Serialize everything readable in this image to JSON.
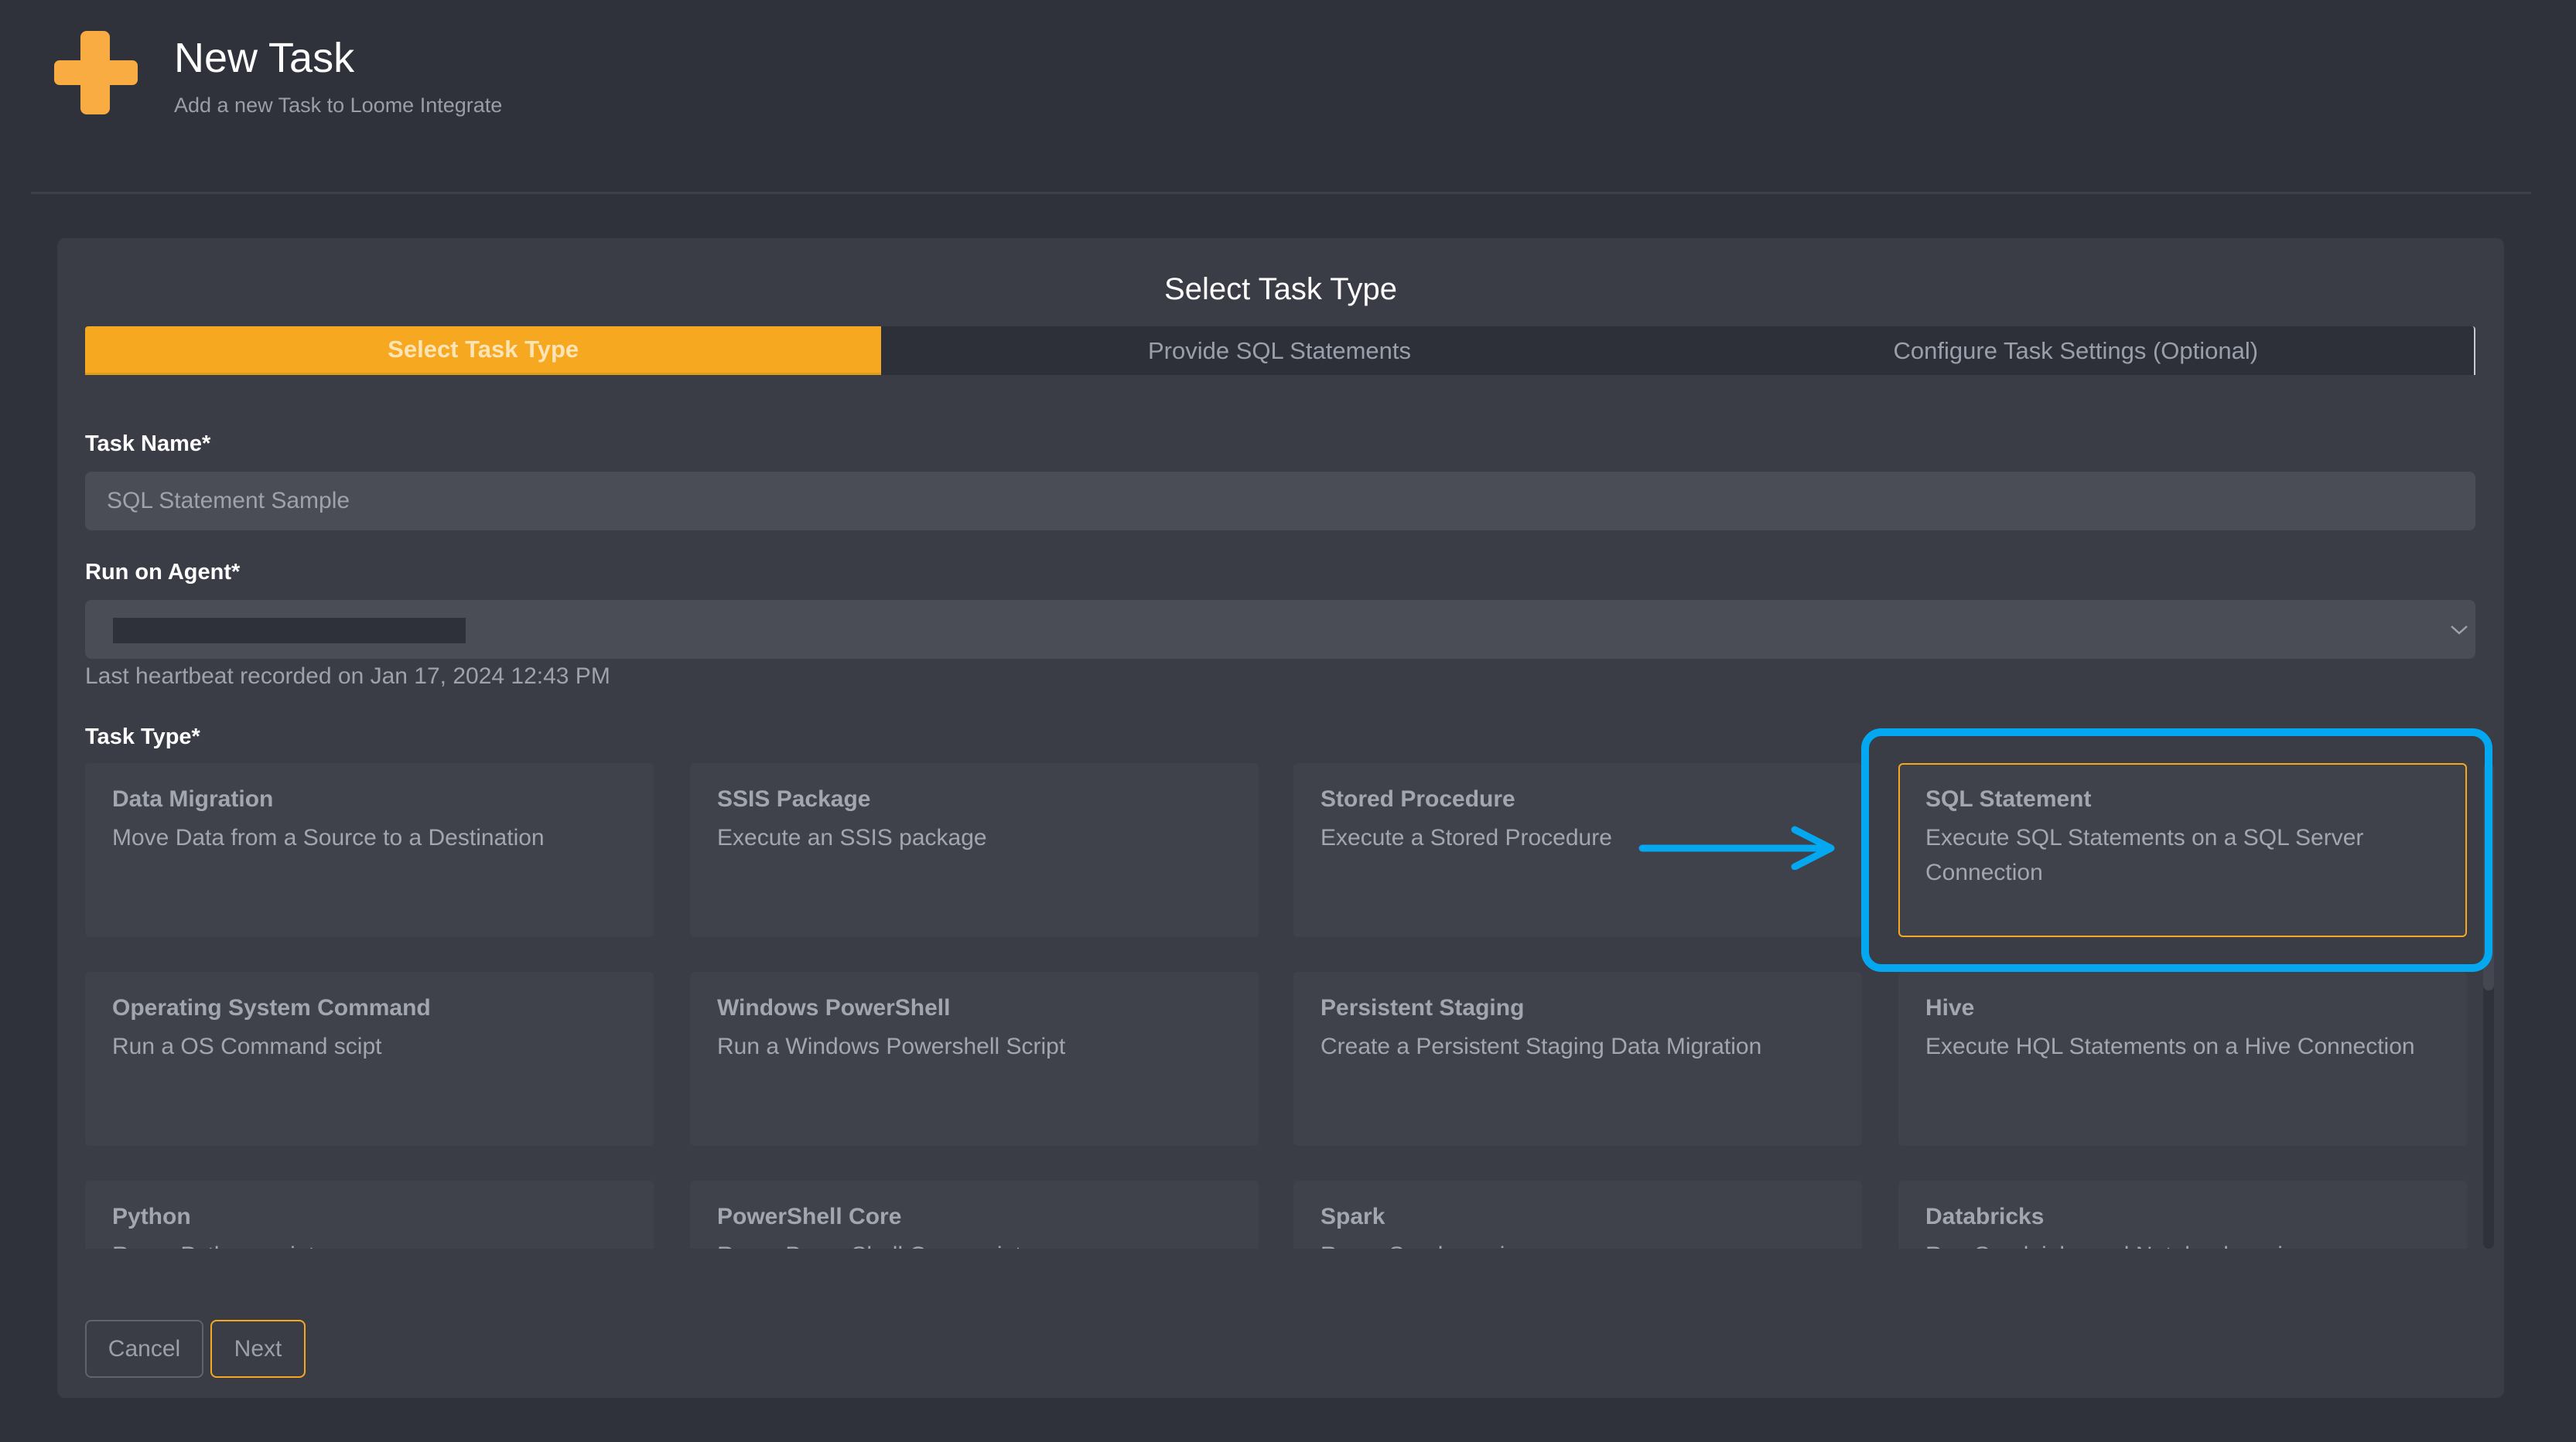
{
  "header": {
    "icon": "plus-icon",
    "title": "New Task",
    "subtitle": "Add a new Task to Loome Integrate"
  },
  "wizard": {
    "title": "Select Task Type",
    "steps": [
      {
        "label": "Select Task Type",
        "active": true
      },
      {
        "label": "Provide SQL Statements",
        "active": false
      },
      {
        "label": "Configure Task Settings (Optional)",
        "active": false
      }
    ]
  },
  "form": {
    "task_name": {
      "label": "Task Name*",
      "value": "SQL Statement Sample"
    },
    "run_on_agent": {
      "label": "Run on Agent*",
      "value": "[redacted]",
      "heartbeat": "Last heartbeat recorded on Jan 17, 2024 12:43 PM"
    },
    "task_type": {
      "label": "Task Type*",
      "selected": "SQL Statement",
      "options": [
        {
          "title": "Data Migration",
          "description": "Move Data from a Source to a Destination"
        },
        {
          "title": "SSIS Package",
          "description": "Execute an SSIS package"
        },
        {
          "title": "Stored Procedure",
          "description": "Execute a Stored Procedure"
        },
        {
          "title": "SQL Statement",
          "description": "Execute SQL Statements on a SQL Server Connection"
        },
        {
          "title": "Operating System Command",
          "description": "Run a OS Command scipt"
        },
        {
          "title": "Windows PowerShell",
          "description": "Run a Windows Powershell Script"
        },
        {
          "title": "Persistent Staging",
          "description": "Create a Persistent Staging Data Migration"
        },
        {
          "title": "Hive",
          "description": "Execute HQL Statements on a Hive Connection"
        },
        {
          "title": "Python",
          "description": "Run a Python script"
        },
        {
          "title": "PowerShell Core",
          "description": "Run a PowerShell Core script"
        },
        {
          "title": "Spark",
          "description": "Run a Spark service"
        },
        {
          "title": "Databricks",
          "description": "Run Spark jobs and Notebooks using"
        }
      ]
    }
  },
  "buttons": {
    "cancel": "Cancel",
    "next": "Next"
  },
  "colors": {
    "accent": "#f6a821",
    "annotation": "#03a8f0",
    "background": "#30323b",
    "panel": "#3a3c46"
  }
}
